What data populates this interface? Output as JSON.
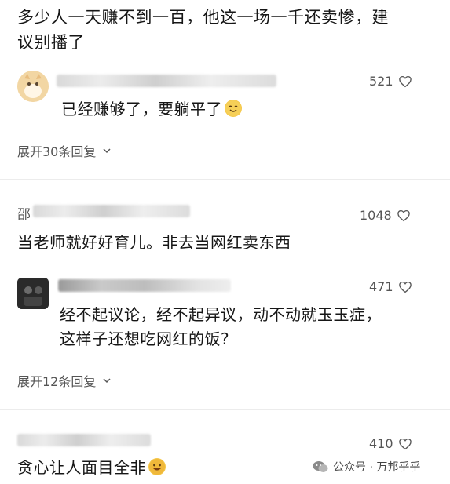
{
  "top_comment": {
    "text_line1": "多少人一天赚不到一百，他这一场一千还卖惨，建",
    "text_line2": "议别播了"
  },
  "reply_1": {
    "text": "已经赚够了，要躺平了",
    "likes": "521"
  },
  "expand_1": {
    "label": "展开30条回复"
  },
  "comment_2": {
    "name_initial": "邵",
    "text": "当老师就好好育儿。非去当网红卖东西",
    "likes": "1048"
  },
  "reply_2": {
    "text_line1": "经不起议论，经不起异议，动不动就玉玉症，",
    "text_line2": "这样子还想吃网红的饭?",
    "likes": "471"
  },
  "expand_2": {
    "label": "展开12条回复"
  },
  "comment_3": {
    "text": "贪心让人面目全非",
    "likes": "410"
  },
  "watermark": {
    "label": "公众号 · 万邦乎乎"
  },
  "colors": {
    "text": "#161616",
    "meta": "#555555",
    "background": "#ffffff"
  }
}
